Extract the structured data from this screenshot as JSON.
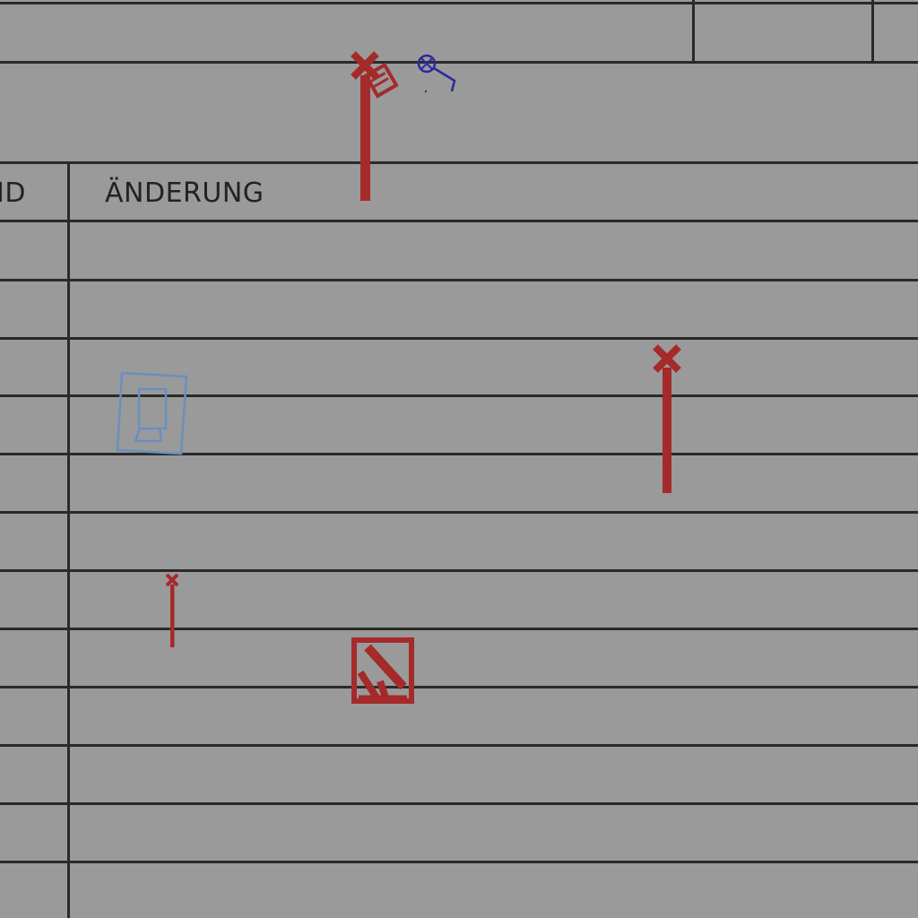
{
  "table": {
    "id_header": "ID",
    "change_header": "ÄNDERUNG",
    "rows": [
      {
        "id": "",
        "change": ""
      },
      {
        "id": "",
        "change": ""
      },
      {
        "id": "",
        "change": ""
      },
      {
        "id": "",
        "change": ""
      },
      {
        "id": "",
        "change": ""
      },
      {
        "id": "",
        "change": ""
      },
      {
        "id": "",
        "change": ""
      },
      {
        "id": "",
        "change": ""
      },
      {
        "id": "",
        "change": ""
      },
      {
        "id": "",
        "change": ""
      },
      {
        "id": "",
        "change": ""
      },
      {
        "id": "",
        "change": ""
      }
    ]
  },
  "markers": {
    "icons": [
      "close-icon",
      "edit-marker-icon",
      "search-marker-icon",
      "portrait-frame-icon",
      "hatched-square-icon"
    ],
    "colors": {
      "marker_red": "#a52a2a",
      "marker_blue": "#2a2aa0",
      "frame_blue": "#6a8fc0",
      "grid": "#2a2a2a",
      "background": "#9a9a9a"
    }
  }
}
